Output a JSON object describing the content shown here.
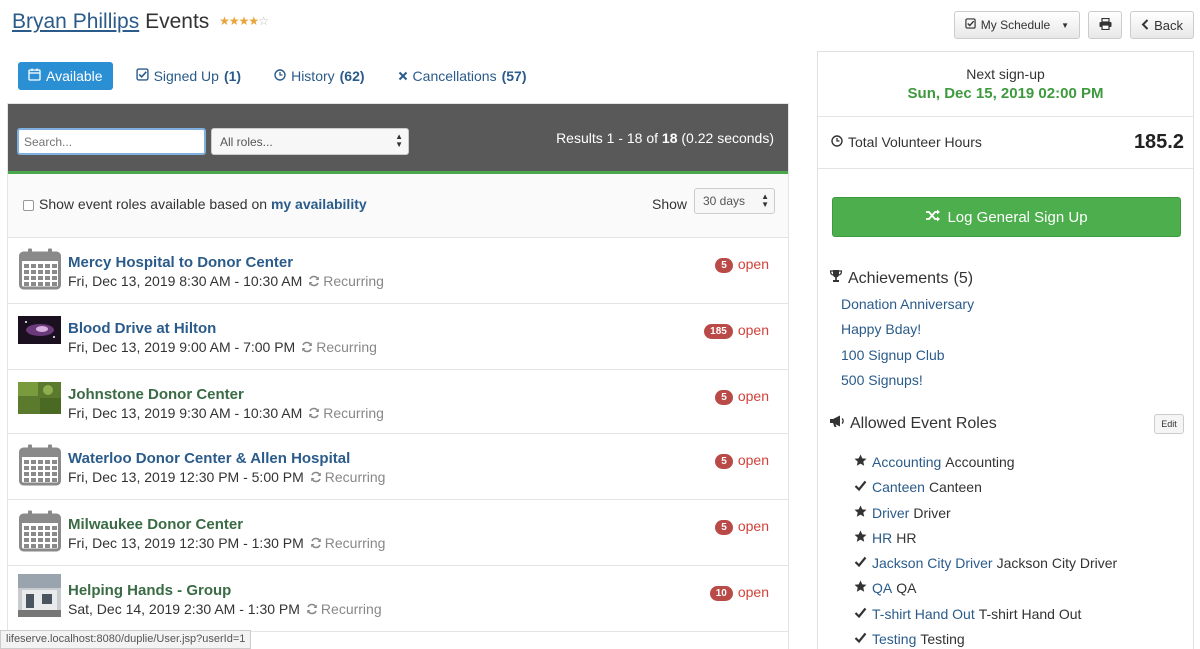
{
  "header": {
    "name": "Bryan Phillips",
    "title_suffix": "Events",
    "rating": {
      "filled": 4,
      "total": 5
    },
    "my_schedule_label": "My Schedule",
    "back_label": "Back"
  },
  "tabs": [
    {
      "label": "Available",
      "count": "",
      "active": true,
      "icon": "calendar-icon"
    },
    {
      "label": "Signed Up",
      "count": "(1)",
      "active": false,
      "icon": "check-square-icon"
    },
    {
      "label": "History",
      "count": "(62)",
      "active": false,
      "icon": "clock-icon"
    },
    {
      "label": "Cancellations",
      "count": "(57)",
      "active": false,
      "icon": "x-icon"
    }
  ],
  "search": {
    "placeholder": "Search...",
    "roles_selected": "All roles...",
    "results_prefix": "Results",
    "results_range": "1 - 18",
    "results_of": "of",
    "results_total": "18",
    "results_time": "(0.22 seconds)"
  },
  "filter": {
    "label": "Show event roles available based on",
    "link": "my availability",
    "show_label": "Show",
    "days_selected": "30 days"
  },
  "events": [
    {
      "title": "Mercy Hospital to Donor Center",
      "date": "Fri, Dec 13, 2019 8:30 AM - 10:30 AM",
      "recurring": "Recurring",
      "open_count": "5",
      "open_label": "open",
      "thumb": "calendar",
      "color": "#2a5b8a"
    },
    {
      "title": "Blood Drive at Hilton",
      "date": "Fri, Dec 13, 2019 9:00 AM - 7:00 PM",
      "recurring": "Recurring",
      "open_count": "185",
      "open_label": "open",
      "thumb": "photo-dark",
      "color": "#2a5b8a"
    },
    {
      "title": "Johnstone Donor Center",
      "date": "Fri, Dec 13, 2019 9:30 AM - 10:30 AM",
      "recurring": "Recurring",
      "open_count": "5",
      "open_label": "open",
      "thumb": "photo-green",
      "color": "#3a6b45"
    },
    {
      "title": "Waterloo Donor Center & Allen Hospital",
      "date": "Fri, Dec 13, 2019 12:30 PM - 5:00 PM",
      "recurring": "Recurring",
      "open_count": "5",
      "open_label": "open",
      "thumb": "calendar",
      "color": "#2a5b8a"
    },
    {
      "title": "Milwaukee Donor Center",
      "date": "Fri, Dec 13, 2019 12:30 PM - 1:30 PM",
      "recurring": "Recurring",
      "open_count": "5",
      "open_label": "open",
      "thumb": "calendar",
      "color": "#3a6b45"
    },
    {
      "title": "Helping Hands - Group",
      "date": "Sat, Dec 14, 2019 2:30 AM - 1:30 PM",
      "recurring": "Recurring",
      "open_count": "10",
      "open_label": "open",
      "thumb": "photo-building",
      "color": "#3a6b45"
    }
  ],
  "status_url": "lifeserve.localhost:8080/duplie/User.jsp?userId=1",
  "sidebar": {
    "next_label": "Next sign-up",
    "next_date": "Sun, Dec 15, 2019 02:00 PM",
    "hours_label": "Total Volunteer Hours",
    "hours_value": "185.2",
    "log_button": "Log General Sign Up",
    "achievements_label": "Achievements",
    "achievements_count": "(5)",
    "achievements": [
      "Donation Anniversary",
      "Happy Bday!",
      "100 Signup Club",
      "500 Signups!"
    ],
    "roles_label": "Allowed Event Roles",
    "edit_label": "Edit",
    "roles": [
      {
        "icon": "star-icon",
        "link": "Accounting",
        "text": "Accounting"
      },
      {
        "icon": "check-icon",
        "link": "Canteen",
        "text": "Canteen"
      },
      {
        "icon": "star-icon",
        "link": "Driver",
        "text": "Driver"
      },
      {
        "icon": "star-icon",
        "link": "HR",
        "text": "HR"
      },
      {
        "icon": "check-icon",
        "link": "Jackson City Driver",
        "text": "Jackson City Driver"
      },
      {
        "icon": "star-icon",
        "link": "QA",
        "text": "QA"
      },
      {
        "icon": "check-icon",
        "link": "T-shirt Hand Out",
        "text": "T-shirt Hand Out"
      },
      {
        "icon": "check-icon",
        "link": "Testing",
        "text": "Testing"
      }
    ]
  }
}
